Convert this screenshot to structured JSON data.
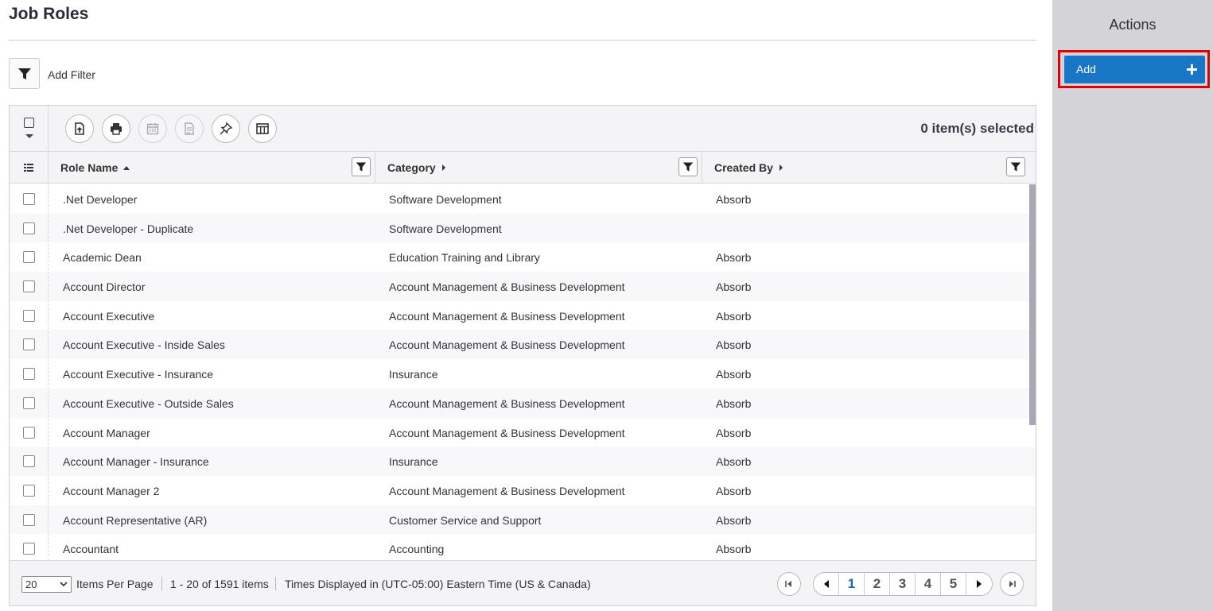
{
  "page": {
    "title": "Job Roles"
  },
  "filter": {
    "add_label": "Add Filter"
  },
  "grid": {
    "selected_count": "0 item(s) selected",
    "toolbar_icons": [
      "export-icon",
      "print-icon",
      "calendar-icon",
      "report-icon",
      "pin-icon",
      "columns-icon"
    ],
    "columns": [
      {
        "label": "Role Name",
        "sort": "ascending"
      },
      {
        "label": "Category",
        "sort": "none"
      },
      {
        "label": "Created By",
        "sort": "none"
      }
    ],
    "rows": [
      {
        "role": ".Net Developer",
        "category": "Software Development",
        "created_by": "Absorb"
      },
      {
        "role": ".Net Developer - Duplicate",
        "category": "Software Development",
        "created_by": ""
      },
      {
        "role": "Academic Dean",
        "category": "Education Training and Library",
        "created_by": "Absorb"
      },
      {
        "role": "Account Director",
        "category": "Account Management & Business Development",
        "created_by": "Absorb"
      },
      {
        "role": "Account Executive",
        "category": "Account Management & Business Development",
        "created_by": "Absorb"
      },
      {
        "role": "Account Executive - Inside Sales",
        "category": "Account Management & Business Development",
        "created_by": "Absorb"
      },
      {
        "role": "Account Executive - Insurance",
        "category": "Insurance",
        "created_by": "Absorb"
      },
      {
        "role": "Account Executive - Outside Sales",
        "category": "Account Management & Business Development",
        "created_by": "Absorb"
      },
      {
        "role": "Account Manager",
        "category": "Account Management & Business Development",
        "created_by": "Absorb"
      },
      {
        "role": "Account Manager - Insurance",
        "category": "Insurance",
        "created_by": "Absorb"
      },
      {
        "role": "Account Manager 2",
        "category": "Account Management & Business Development",
        "created_by": "Absorb"
      },
      {
        "role": "Account Representative (AR)",
        "category": "Customer Service and Support",
        "created_by": "Absorb"
      },
      {
        "role": "Accountant",
        "category": "Accounting",
        "created_by": "Absorb"
      }
    ]
  },
  "footer": {
    "per_page_value": "20",
    "per_page_label": "Items Per Page",
    "range_text": "1 - 20 of 1591 items",
    "timezone_text": "Times Displayed in (UTC-05:00) Eastern Time (US & Canada)",
    "pages": [
      "1",
      "2",
      "3",
      "4",
      "5"
    ],
    "current_page": "1"
  },
  "sidebar": {
    "title": "Actions",
    "add_label": "Add",
    "add_icon": "+",
    "accent_color": "#1976c6",
    "highlight_color": "#e00000"
  }
}
